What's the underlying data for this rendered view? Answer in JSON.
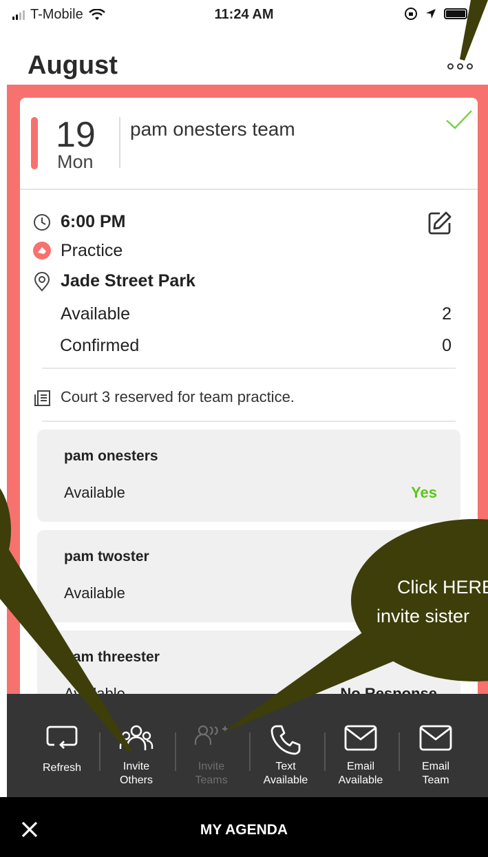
{
  "status": {
    "carrier": "T-Mobile",
    "time": "11:24 AM"
  },
  "header": {
    "month": "August"
  },
  "event": {
    "day_num": "19",
    "day_name": "Mon",
    "team": "pam onesters team",
    "time": "6:00 PM",
    "type": "Practice",
    "location": "Jade Street Park",
    "available_label": "Available",
    "available_count": "2",
    "confirmed_label": "Confirmed",
    "confirmed_count": "0",
    "note": "Court 3 reserved for team practice."
  },
  "responses": [
    {
      "name": "pam onesters",
      "label": "Available",
      "value": "Yes"
    },
    {
      "name": "pam twoster",
      "label": "Available",
      "value": ""
    },
    {
      "name": "pam threester",
      "label": "Available",
      "value": "No Response"
    }
  ],
  "toolbar": {
    "refresh": "Refresh",
    "invite_others_1": "Invite",
    "invite_others_2": "Others",
    "invite_teams_1": "Invite",
    "invite_teams_2": "Teams",
    "text_available_1": "Text",
    "text_available_2": "Available",
    "email_available_1": "Email",
    "email_available_2": "Available",
    "email_team_1": "Email",
    "email_team_2": "Team"
  },
  "bottom": {
    "title": "MY AGENDA"
  },
  "annotation": {
    "line1": "Click HERE",
    "line2": "invite sister"
  },
  "colors": {
    "accent_red": "#f7726e",
    "yes_green": "#5cc51a",
    "callout": "#3d3e0a",
    "toolbar": "#353535"
  }
}
